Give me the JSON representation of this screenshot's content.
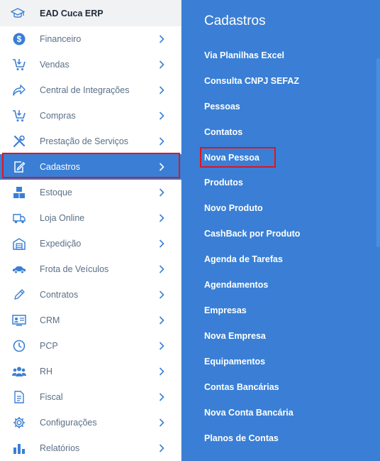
{
  "brand": {
    "title": "EAD Cuca ERP"
  },
  "sidebar": {
    "items": [
      {
        "label": "Financeiro",
        "icon": "dollar-icon"
      },
      {
        "label": "Vendas",
        "icon": "cart-icon"
      },
      {
        "label": "Central de Integrações",
        "icon": "share-icon"
      },
      {
        "label": "Compras",
        "icon": "cart-icon"
      },
      {
        "label": "Prestação de Serviços",
        "icon": "tools-icon"
      },
      {
        "label": "Cadastros",
        "icon": "edit-icon",
        "active": true
      },
      {
        "label": "Estoque",
        "icon": "boxes-icon"
      },
      {
        "label": "Loja Online",
        "icon": "truck-icon"
      },
      {
        "label": "Expedição",
        "icon": "warehouse-icon"
      },
      {
        "label": "Frota de Veículos",
        "icon": "car-icon"
      },
      {
        "label": "Contratos",
        "icon": "pencil-icon"
      },
      {
        "label": "CRM",
        "icon": "id-card-icon"
      },
      {
        "label": "PCP",
        "icon": "clock-icon"
      },
      {
        "label": "RH",
        "icon": "people-icon"
      },
      {
        "label": "Fiscal",
        "icon": "document-icon"
      },
      {
        "label": "Configurações",
        "icon": "gear-icon"
      },
      {
        "label": "Relatórios",
        "icon": "bar-chart-icon"
      }
    ]
  },
  "submenu": {
    "title": "Cadastros",
    "items": [
      "Via Planilhas Excel",
      "Consulta CNPJ SEFAZ",
      "Pessoas",
      "Contatos",
      "Nova Pessoa",
      "Produtos",
      "Novo Produto",
      "CashBack por Produto",
      "Agenda de Tarefas",
      "Agendamentos",
      "Empresas",
      "Nova Empresa",
      "Equipamentos",
      "Contas Bancárias",
      "Nova Conta Bancária",
      "Planos de Contas"
    ]
  },
  "colors": {
    "accent": "#3a7fd5",
    "icon": "#3a7fd5",
    "text": "#5b6f86",
    "highlight": "#e0151c"
  }
}
